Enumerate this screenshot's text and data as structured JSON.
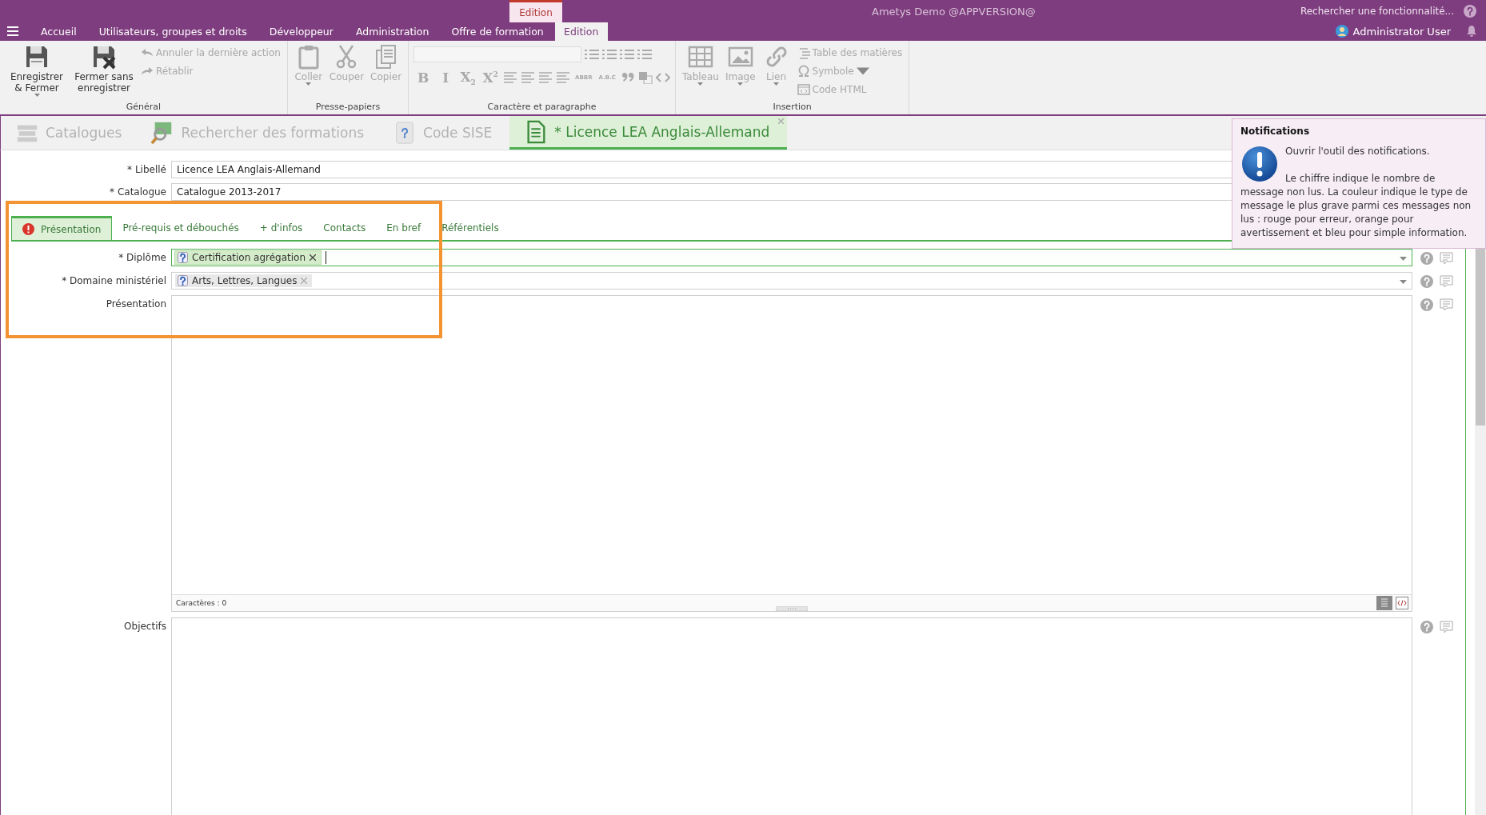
{
  "header": {
    "app_title": "Ametys Demo @APPVERSION@",
    "search_placeholder": "Rechercher une fonctionnalité...",
    "user": "Administrator User",
    "contextual_label": "Edition",
    "tabs": [
      {
        "label": "Accueil",
        "selected": false
      },
      {
        "label": "Utilisateurs, groupes et droits",
        "selected": false
      },
      {
        "label": "Développeur",
        "selected": false
      },
      {
        "label": "Administration",
        "selected": false
      },
      {
        "label": "Offre de formation",
        "selected": false
      },
      {
        "label": "Edition",
        "selected": true
      }
    ]
  },
  "ribbon": {
    "groups": [
      {
        "title": "Général",
        "buttons": [
          {
            "kind": "large",
            "label": "Enregistrer & Fermer",
            "caret": true,
            "disabled": false
          },
          {
            "kind": "large",
            "label": "Fermer sans enregistrer",
            "caret": false,
            "disabled": false
          },
          {
            "kind": "small",
            "label": "Annuler la dernière action",
            "caret": false,
            "disabled": true
          },
          {
            "kind": "small",
            "label": "Rétablir",
            "caret": false,
            "disabled": true
          }
        ]
      },
      {
        "title": "Presse-papiers",
        "buttons": [
          {
            "kind": "large",
            "label": "Coller",
            "caret": true,
            "disabled": true
          },
          {
            "kind": "large",
            "label": "Couper",
            "caret": false,
            "disabled": true
          },
          {
            "kind": "large",
            "label": "Copier",
            "caret": false,
            "disabled": true
          }
        ]
      },
      {
        "title": "Caractère et paragraphe",
        "buttons": [
          {
            "kind": "format",
            "label": "B",
            "disabled": true
          },
          {
            "kind": "format",
            "label": "I",
            "disabled": true
          },
          {
            "kind": "format",
            "label": "X$_{2}$",
            "disabled": true
          },
          {
            "kind": "format",
            "label": "X$^{2}$",
            "disabled": true
          },
          {
            "kind": "tiny",
            "label": "ABBR",
            "disabled": true
          },
          {
            "kind": "tiny",
            "label": "A.B.C",
            "disabled": true
          }
        ]
      },
      {
        "title": "Insertion",
        "buttons": [
          {
            "kind": "large",
            "label": "Tableau",
            "caret": true,
            "disabled": true
          },
          {
            "kind": "large",
            "label": "Image",
            "caret": true,
            "disabled": true
          },
          {
            "kind": "large",
            "label": "Lien",
            "caret": true,
            "disabled": true
          },
          {
            "kind": "small",
            "label": "Table des matières",
            "caret": false,
            "disabled": true
          },
          {
            "kind": "small",
            "label": "Symbole",
            "caret": true,
            "disabled": true
          },
          {
            "kind": "small",
            "label": "Code HTML",
            "caret": false,
            "disabled": true
          }
        ]
      }
    ]
  },
  "document_tabs": [
    {
      "label": "Catalogues",
      "selected": false,
      "closable": false
    },
    {
      "label": "Rechercher des formations",
      "selected": false,
      "closable": false
    },
    {
      "label": "Code SISE",
      "selected": false,
      "closable": false
    },
    {
      "label": "* Licence LEA Anglais-Allemand",
      "selected": true,
      "closable": true
    }
  ],
  "form": {
    "fields": [
      {
        "label": "* Libellé",
        "value": "Licence LEA Anglais-Allemand"
      },
      {
        "label": "* Catalogue",
        "value": "Catalogue 2013-2017"
      }
    ],
    "highlight_frame": true,
    "tabs": [
      {
        "label": "Présentation",
        "selected": true,
        "error": true
      },
      {
        "label": "Pré-requis et débouchés",
        "selected": false,
        "error": false
      },
      {
        "label": "+ d'infos",
        "selected": false,
        "error": false
      },
      {
        "label": "Contacts",
        "selected": false,
        "error": false
      },
      {
        "label": "En bref",
        "selected": false,
        "error": false
      },
      {
        "label": "Référentiels",
        "selected": false,
        "error": false
      }
    ],
    "tab_fields": [
      {
        "kind": "tags",
        "label": "* Diplôme",
        "tags": [
          "Certification agrégation"
        ],
        "focused": true
      },
      {
        "kind": "tags",
        "label": "* Domaine ministériel",
        "tags": [
          "Arts, Lettres, Langues"
        ],
        "focused": false
      },
      {
        "kind": "richtext",
        "label": "Présentation",
        "status": "Caractères : 0"
      },
      {
        "kind": "richtext",
        "label": "Objectifs"
      }
    ]
  },
  "tooltip": {
    "title": "Notifications",
    "lead": "Ouvrir l'outil des notifications.",
    "body": "Le chiffre indique le nombre de message non lus. La couleur indique le type de message le plus grave parmi ces messages non lus : rouge pour erreur, orange pour avertissement et bleu pour simple information."
  }
}
